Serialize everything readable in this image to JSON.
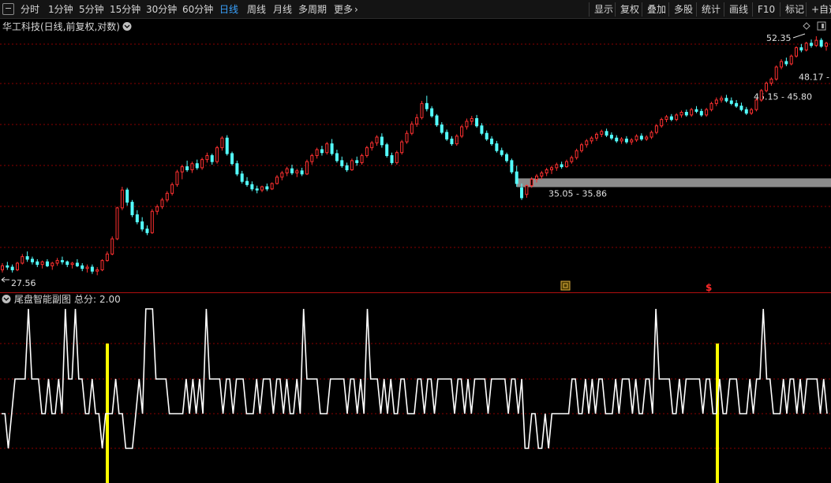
{
  "toolbar": {
    "periods": [
      "分时",
      "1分钟",
      "5分钟",
      "15分钟",
      "30分钟",
      "60分钟",
      "日线",
      "周线",
      "月线",
      "多周期",
      "更多"
    ],
    "active_period": "日线",
    "more_arrow": "›",
    "right_buttons": [
      "显示",
      "复权",
      "叠加",
      "多股",
      "统计",
      "画线",
      "F10",
      "标记",
      "+自选"
    ]
  },
  "main_panel": {
    "title": "华工科技(日线,前复权,对数)",
    "high_marker": "52.35",
    "low_marker": "27.56",
    "zones": [
      {
        "label": "35.05 - 35.86",
        "low": 35.05,
        "high": 35.86
      },
      {
        "label": "45.15 - 45.80",
        "low": 45.15,
        "high": 45.8
      },
      {
        "label": "48.17 -",
        "low": 48.17,
        "high": 48.17
      }
    ],
    "marker_dollar": "$"
  },
  "sub_panel": {
    "title": "尾盘智能副图",
    "score_label": "总分:",
    "score_value": "2.00"
  },
  "colors": {
    "up": "#ff3030",
    "down": "#54ffff",
    "grid": "#8b0000",
    "zone": "#8c8c8c",
    "line": "#ffffff",
    "signal": "#ffff00"
  },
  "chart_data": {
    "type": "candlestick",
    "y_scale": "log",
    "price_range": [
      27.56,
      52.35
    ],
    "candles": [
      [
        28.4,
        28.9,
        28.2,
        28.7
      ],
      [
        28.7,
        29.0,
        28.4,
        28.6
      ],
      [
        28.6,
        28.8,
        28.2,
        28.4
      ],
      [
        28.4,
        29.0,
        28.3,
        28.9
      ],
      [
        28.9,
        29.6,
        28.8,
        29.4
      ],
      [
        29.4,
        29.8,
        29.0,
        29.2
      ],
      [
        29.2,
        29.4,
        28.8,
        29.0
      ],
      [
        29.0,
        29.2,
        28.6,
        28.8
      ],
      [
        28.8,
        29.1,
        28.5,
        29.0
      ],
      [
        29.0,
        29.2,
        28.6,
        28.7
      ],
      [
        28.7,
        29.0,
        28.4,
        28.9
      ],
      [
        28.9,
        29.3,
        28.7,
        29.1
      ],
      [
        29.1,
        29.4,
        28.8,
        29.0
      ],
      [
        29.0,
        29.1,
        28.6,
        28.8
      ],
      [
        28.8,
        29.0,
        28.5,
        28.9
      ],
      [
        28.9,
        29.2,
        28.6,
        28.7
      ],
      [
        28.7,
        28.9,
        28.3,
        28.5
      ],
      [
        28.5,
        28.8,
        28.2,
        28.6
      ],
      [
        28.6,
        28.8,
        28.1,
        28.3
      ],
      [
        28.3,
        28.6,
        28.0,
        28.4
      ],
      [
        28.4,
        29.2,
        28.3,
        29.1
      ],
      [
        29.1,
        29.8,
        29.0,
        29.6
      ],
      [
        29.6,
        31.0,
        29.5,
        30.8
      ],
      [
        30.8,
        33.5,
        30.7,
        33.4
      ],
      [
        33.4,
        35.3,
        33.2,
        35.0
      ],
      [
        35.0,
        35.2,
        33.6,
        33.9
      ],
      [
        33.9,
        34.1,
        32.6,
        32.8
      ],
      [
        32.8,
        33.2,
        32.0,
        32.2
      ],
      [
        32.2,
        32.6,
        31.4,
        31.6
      ],
      [
        31.6,
        31.9,
        31.1,
        31.3
      ],
      [
        31.3,
        33.3,
        31.2,
        33.1
      ],
      [
        33.1,
        33.7,
        32.8,
        33.5
      ],
      [
        33.5,
        34.3,
        33.3,
        34.1
      ],
      [
        34.1,
        34.9,
        33.9,
        34.7
      ],
      [
        34.7,
        35.7,
        34.5,
        35.5
      ],
      [
        35.5,
        36.9,
        35.3,
        36.7
      ],
      [
        36.7,
        37.4,
        36.0,
        37.2
      ],
      [
        37.2,
        37.8,
        36.7,
        36.9
      ],
      [
        36.9,
        37.7,
        36.6,
        37.5
      ],
      [
        37.5,
        37.9,
        36.9,
        37.1
      ],
      [
        37.1,
        38.1,
        36.9,
        37.9
      ],
      [
        37.9,
        38.6,
        37.6,
        38.3
      ],
      [
        38.3,
        38.5,
        37.4,
        37.7
      ],
      [
        37.7,
        39.3,
        37.5,
        39.1
      ],
      [
        39.1,
        40.3,
        38.8,
        40.1
      ],
      [
        40.1,
        40.4,
        38.3,
        38.5
      ],
      [
        38.5,
        38.7,
        37.3,
        37.5
      ],
      [
        37.5,
        37.8,
        36.3,
        36.5
      ],
      [
        36.5,
        36.8,
        35.6,
        35.8
      ],
      [
        35.8,
        36.2,
        35.3,
        35.5
      ],
      [
        35.5,
        35.8,
        34.9,
        35.1
      ],
      [
        35.1,
        35.4,
        34.7,
        35.0
      ],
      [
        35.0,
        35.4,
        34.8,
        35.3
      ],
      [
        35.3,
        35.6,
        34.9,
        35.1
      ],
      [
        35.1,
        35.7,
        35.0,
        35.6
      ],
      [
        35.6,
        36.4,
        35.5,
        36.2
      ],
      [
        36.2,
        36.8,
        35.9,
        36.6
      ],
      [
        36.6,
        37.2,
        36.3,
        37.0
      ],
      [
        37.0,
        37.4,
        36.4,
        36.6
      ],
      [
        36.6,
        37.0,
        36.2,
        36.8
      ],
      [
        36.8,
        37.1,
        36.3,
        36.5
      ],
      [
        36.5,
        37.9,
        36.4,
        37.7
      ],
      [
        37.7,
        38.5,
        37.4,
        38.3
      ],
      [
        38.3,
        39.1,
        38.0,
        38.9
      ],
      [
        38.9,
        39.3,
        38.3,
        38.6
      ],
      [
        38.6,
        39.7,
        38.4,
        39.5
      ],
      [
        39.5,
        40.0,
        38.3,
        38.5
      ],
      [
        38.5,
        38.9,
        37.6,
        37.8
      ],
      [
        37.8,
        38.2,
        37.1,
        37.3
      ],
      [
        37.3,
        37.6,
        36.7,
        36.9
      ],
      [
        36.9,
        38.0,
        36.8,
        37.8
      ],
      [
        37.8,
        38.2,
        37.3,
        37.6
      ],
      [
        37.6,
        38.5,
        37.4,
        38.3
      ],
      [
        38.3,
        39.3,
        38.1,
        39.1
      ],
      [
        39.1,
        39.8,
        38.8,
        39.6
      ],
      [
        39.6,
        40.4,
        39.3,
        40.2
      ],
      [
        40.2,
        40.6,
        39.1,
        39.4
      ],
      [
        39.4,
        39.6,
        38.1,
        38.3
      ],
      [
        38.3,
        38.6,
        37.4,
        37.6
      ],
      [
        37.6,
        38.8,
        37.4,
        38.6
      ],
      [
        38.6,
        39.9,
        38.4,
        39.7
      ],
      [
        39.7,
        40.9,
        39.5,
        40.6
      ],
      [
        40.6,
        41.9,
        40.4,
        41.6
      ],
      [
        41.6,
        42.7,
        41.3,
        42.3
      ],
      [
        42.3,
        44.2,
        42.1,
        43.9
      ],
      [
        43.9,
        44.8,
        43.0,
        43.3
      ],
      [
        43.3,
        43.6,
        42.3,
        42.5
      ],
      [
        42.5,
        42.7,
        41.3,
        41.5
      ],
      [
        41.5,
        41.8,
        40.5,
        40.7
      ],
      [
        40.7,
        41.0,
        39.8,
        40.0
      ],
      [
        40.0,
        40.3,
        39.3,
        39.5
      ],
      [
        39.5,
        40.5,
        39.3,
        40.3
      ],
      [
        40.3,
        41.5,
        40.1,
        41.3
      ],
      [
        41.3,
        42.2,
        41.0,
        41.9
      ],
      [
        41.9,
        42.5,
        41.5,
        42.2
      ],
      [
        42.2,
        42.6,
        41.2,
        41.4
      ],
      [
        41.4,
        41.7,
        40.4,
        40.6
      ],
      [
        40.6,
        40.9,
        39.8,
        40.0
      ],
      [
        40.0,
        40.3,
        39.3,
        39.5
      ],
      [
        39.5,
        39.8,
        38.6,
        38.8
      ],
      [
        38.8,
        39.1,
        38.2,
        38.4
      ],
      [
        38.4,
        38.6,
        37.6,
        37.8
      ],
      [
        37.8,
        38.0,
        36.5,
        36.7
      ],
      [
        36.7,
        37.3,
        35.3,
        35.6
      ],
      [
        35.2,
        35.6,
        34.1,
        34.3
      ],
      [
        34.6,
        35.5,
        34.3,
        35.4
      ],
      [
        35.4,
        36.2,
        35.2,
        36.0
      ],
      [
        36.0,
        36.5,
        35.7,
        36.3
      ],
      [
        36.3,
        36.8,
        36.0,
        36.6
      ],
      [
        36.6,
        37.1,
        36.3,
        36.9
      ],
      [
        36.9,
        37.3,
        36.5,
        37.1
      ],
      [
        37.1,
        37.6,
        36.8,
        37.4
      ],
      [
        37.4,
        37.7,
        37.0,
        37.2
      ],
      [
        37.2,
        37.9,
        37.1,
        37.7
      ],
      [
        37.7,
        38.3,
        37.5,
        38.1
      ],
      [
        38.1,
        39.0,
        37.9,
        38.8
      ],
      [
        38.8,
        39.6,
        38.6,
        39.4
      ],
      [
        39.4,
        40.0,
        39.1,
        39.8
      ],
      [
        39.8,
        40.3,
        39.5,
        40.1
      ],
      [
        40.1,
        40.7,
        39.8,
        40.5
      ],
      [
        40.5,
        41.0,
        40.2,
        40.8
      ],
      [
        40.8,
        41.1,
        40.2,
        40.4
      ],
      [
        40.4,
        40.7,
        39.9,
        40.1
      ],
      [
        40.1,
        40.4,
        39.6,
        39.8
      ],
      [
        39.8,
        40.2,
        39.5,
        40.0
      ],
      [
        40.0,
        40.3,
        39.5,
        39.7
      ],
      [
        39.7,
        40.1,
        39.4,
        39.9
      ],
      [
        39.9,
        40.5,
        39.7,
        40.3
      ],
      [
        40.3,
        40.6,
        39.8,
        40.0
      ],
      [
        40.0,
        40.4,
        39.8,
        40.2
      ],
      [
        40.2,
        40.9,
        40.0,
        40.7
      ],
      [
        40.7,
        41.6,
        40.5,
        41.4
      ],
      [
        41.4,
        42.3,
        41.2,
        42.1
      ],
      [
        42.1,
        42.6,
        41.8,
        42.4
      ],
      [
        42.4,
        42.7,
        41.9,
        42.1
      ],
      [
        42.1,
        42.8,
        41.9,
        42.6
      ],
      [
        42.6,
        43.1,
        42.3,
        42.9
      ],
      [
        42.9,
        43.2,
        42.4,
        42.6
      ],
      [
        42.6,
        43.4,
        42.4,
        43.2
      ],
      [
        43.2,
        43.6,
        42.8,
        43.0
      ],
      [
        43.0,
        43.3,
        42.4,
        42.6
      ],
      [
        42.6,
        43.4,
        42.4,
        43.2
      ],
      [
        43.2,
        44.1,
        43.0,
        43.9
      ],
      [
        43.9,
        44.6,
        43.6,
        44.3
      ],
      [
        44.3,
        44.8,
        44.0,
        44.5
      ],
      [
        44.5,
        44.9,
        44.0,
        44.2
      ],
      [
        44.2,
        44.6,
        43.7,
        43.9
      ],
      [
        43.9,
        44.3,
        43.4,
        43.6
      ],
      [
        43.6,
        44.0,
        43.0,
        43.2
      ],
      [
        43.2,
        43.5,
        42.6,
        42.8
      ],
      [
        42.8,
        43.4,
        42.6,
        43.2
      ],
      [
        43.2,
        44.5,
        43.0,
        44.3
      ],
      [
        44.3,
        45.6,
        44.1,
        45.4
      ],
      [
        45.4,
        46.5,
        45.2,
        46.3
      ],
      [
        46.3,
        47.0,
        46.0,
        46.8
      ],
      [
        46.8,
        48.5,
        46.6,
        48.3
      ],
      [
        48.3,
        49.3,
        48.0,
        49.0
      ],
      [
        49.0,
        49.5,
        48.4,
        48.7
      ],
      [
        48.7,
        49.9,
        48.5,
        49.7
      ],
      [
        49.7,
        51.0,
        49.5,
        50.8
      ],
      [
        50.8,
        51.3,
        50.2,
        50.5
      ],
      [
        50.5,
        51.6,
        50.3,
        51.4
      ],
      [
        51.4,
        51.9,
        50.8,
        51.1
      ],
      [
        51.1,
        52.35,
        50.9,
        51.8
      ],
      [
        51.8,
        52.1,
        50.8,
        51.0
      ],
      [
        51.0,
        51.6,
        50.4,
        51.4
      ]
    ],
    "sub_series_levels": [
      "0",
      "0.5",
      "1",
      "1.5",
      "2",
      "2.5"
    ],
    "sub_series": [
      1,
      1,
      0,
      1,
      2,
      2,
      2,
      2,
      3,
      2,
      2,
      2,
      1,
      1,
      2,
      1,
      1,
      2,
      1,
      3,
      2,
      2,
      3,
      2,
      2,
      1,
      1,
      2,
      1,
      1,
      0,
      1,
      1,
      1,
      2,
      1,
      1,
      0,
      0,
      0,
      1,
      2,
      1,
      3,
      3,
      3,
      2,
      2,
      2,
      2,
      1,
      1,
      1,
      1,
      1,
      2,
      1,
      2,
      1,
      2,
      1,
      3,
      2,
      2,
      2,
      2,
      1,
      2,
      2,
      1,
      2,
      2,
      2,
      1,
      1,
      1,
      2,
      1,
      2,
      2,
      2,
      1,
      2,
      2,
      1,
      2,
      1,
      1,
      2,
      1,
      3,
      2,
      2,
      2,
      2,
      1,
      1,
      1,
      2,
      2,
      2,
      2,
      2,
      1,
      2,
      2,
      1,
      2,
      1,
      3,
      2,
      2,
      2,
      1,
      2,
      1,
      2,
      1,
      1,
      2,
      2,
      1,
      1,
      1,
      2,
      2,
      1,
      2,
      2,
      1,
      2,
      2,
      2,
      2,
      2,
      1,
      2,
      2,
      1,
      2,
      1,
      2,
      2,
      2,
      2,
      1,
      2,
      2,
      2,
      2,
      2,
      1,
      2,
      2,
      1,
      2,
      0,
      0,
      1,
      1,
      0,
      0,
      1,
      0,
      1,
      1,
      1,
      1,
      1,
      1,
      2,
      2,
      1,
      1,
      2,
      1,
      2,
      1,
      2,
      2,
      1,
      1,
      1,
      2,
      1,
      2,
      2,
      2,
      1,
      2,
      1,
      1,
      2,
      2,
      1,
      3,
      2,
      2,
      2,
      2,
      1,
      1,
      2,
      1,
      2,
      2,
      2,
      2,
      2,
      1,
      2,
      2,
      1,
      1,
      2,
      1,
      1,
      2,
      2,
      2,
      1,
      1,
      1,
      2,
      1,
      2,
      2,
      3,
      2,
      2,
      1,
      1,
      1,
      2,
      1,
      2,
      2,
      1,
      2,
      1,
      2,
      2,
      2,
      2,
      1,
      2,
      1
    ],
    "signals": [
      34,
      226
    ]
  }
}
